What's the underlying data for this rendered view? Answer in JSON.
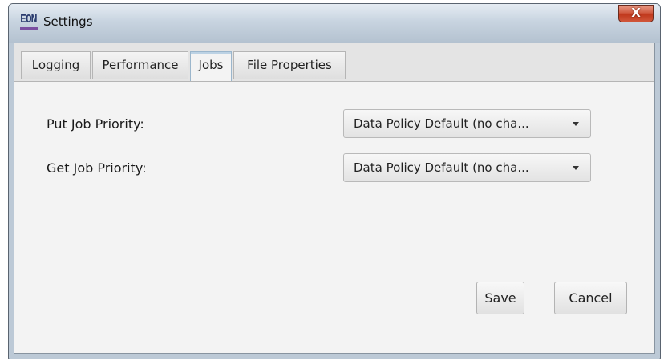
{
  "window": {
    "title": "Settings",
    "logo_text": "EON",
    "close_label": "X"
  },
  "tabs": [
    {
      "label": "Logging",
      "active": false
    },
    {
      "label": "Performance",
      "active": false
    },
    {
      "label": "Jobs",
      "active": true
    },
    {
      "label": "File Properties",
      "active": false
    }
  ],
  "jobs": {
    "put_label": "Put Job Priority:",
    "put_value": "Data Policy Default (no cha...",
    "get_label": "Get Job Priority:",
    "get_value": "Data Policy Default (no cha..."
  },
  "buttons": {
    "save": "Save",
    "cancel": "Cancel"
  }
}
